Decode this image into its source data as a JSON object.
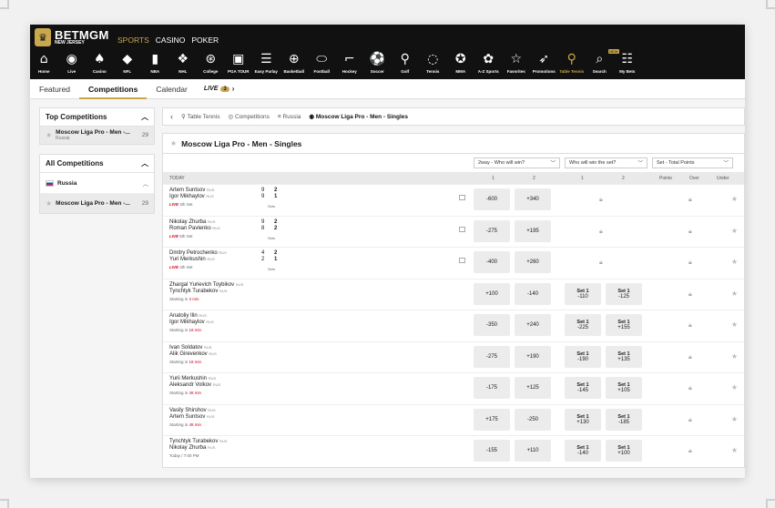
{
  "header": {
    "brand_top": "BETMGM",
    "brand_sub": "NEW JERSEY",
    "nav": [
      "SPORTS",
      "CASINO",
      "POKER"
    ],
    "nav_active": "SPORTS"
  },
  "iconnav": [
    {
      "label": "Home",
      "glyph": "⌂"
    },
    {
      "label": "Live",
      "glyph": "◉"
    },
    {
      "label": "Casino",
      "glyph": "♠"
    },
    {
      "label": "NFL",
      "glyph": "◆"
    },
    {
      "label": "NBA",
      "glyph": "▮"
    },
    {
      "label": "NHL",
      "glyph": "❖"
    },
    {
      "label": "College",
      "glyph": "⊛"
    },
    {
      "label": "PGA TOUR",
      "glyph": "▣"
    },
    {
      "label": "Easy Parlay",
      "glyph": "☰"
    },
    {
      "label": "Basketball",
      "glyph": "⊕"
    },
    {
      "label": "Football",
      "glyph": "⬭"
    },
    {
      "label": "Hockey",
      "glyph": "⌐"
    },
    {
      "label": "Soccer",
      "glyph": "⚽"
    },
    {
      "label": "Golf",
      "glyph": "⚲"
    },
    {
      "label": "Tennis",
      "glyph": "◌"
    },
    {
      "label": "MMA",
      "glyph": "✪"
    },
    {
      "label": "A-Z Sports",
      "glyph": "✿"
    },
    {
      "label": "Favorites",
      "glyph": "☆"
    },
    {
      "label": "Promotions",
      "glyph": "➶"
    },
    {
      "label": "Table Tennis",
      "glyph": "⚲"
    },
    {
      "label": "Search",
      "glyph": "⌕"
    },
    {
      "label": "My Bets",
      "glyph": "☷"
    }
  ],
  "search_badge": "NEW",
  "tabs": [
    "Featured",
    "Competitions",
    "Calendar"
  ],
  "live_tab": {
    "label": "LIVE",
    "count": "3"
  },
  "sidebar": {
    "top_title": "Top Competitions",
    "top_item": {
      "name": "Moscow Liga Pro - Men -...",
      "sub": "Russia",
      "count": "29"
    },
    "all_title": "All Competitions",
    "country": "Russia",
    "all_item": {
      "name": "Moscow Liga Pro - Men -...",
      "count": "29"
    }
  },
  "breadcrumb": [
    "Table Tennis",
    "Competitions",
    "Russia",
    "Moscow Liga Pro - Men - Singles"
  ],
  "main_title": "Moscow Liga Pro - Men - Singles",
  "markets": {
    "m1": "2way - Who will win?",
    "m2": "Who will win the set?",
    "m3": "Set - Total Points"
  },
  "columns": {
    "today": "TODAY",
    "c1": "1",
    "c2": "2",
    "c3": "1",
    "c4": "2",
    "points": "Points",
    "over": "Over",
    "under": "Under"
  },
  "rus": "RUS",
  "sets_label": "Sets",
  "set_label": "Set 1",
  "matches": [
    {
      "p1": "Artem Suntsov",
      "p2": "Igor Mikhaylov",
      "live": "LIVE",
      "info": "4th Set",
      "s1a": "9",
      "s1b": "2",
      "s2a": "9",
      "s2b": "1",
      "o1": "-600",
      "o2": "+340"
    },
    {
      "p1": "Nikolay Zhurba",
      "p2": "Roman Pavlenko",
      "live": "LIVE",
      "info": "5th Set",
      "s1a": "9",
      "s1b": "2",
      "s2a": "8",
      "s2b": "2",
      "o1": "-275",
      "o2": "+195"
    },
    {
      "p1": "Dmitry Petrochenko",
      "p2": "Yuri Merkushin",
      "live": "LIVE",
      "info": "4th Set",
      "s1a": "4",
      "s1b": "2",
      "s2a": "2",
      "s2b": "1",
      "o1": "-400",
      "o2": "+260"
    },
    {
      "p1": "Zhargal Yurievich Toybikov",
      "p2": "Tynchtyk Turabekov",
      "pre": "Starting in",
      "mins": "3 min",
      "o1": "+100",
      "o2": "-140",
      "s1": "-110",
      "s2": "-125"
    },
    {
      "p1": "Anatoliy Ilin",
      "p2": "Igor Mikhaylov",
      "pre": "Starting in",
      "mins": "18 min",
      "o1": "-350",
      "o2": "+240",
      "s1": "-225",
      "s2": "+155"
    },
    {
      "p1": "Ivan Soldatov",
      "p2": "Alik Girevenkov",
      "pre": "Starting in",
      "mins": "18 min",
      "o1": "-275",
      "o2": "+190",
      "s1": "-190",
      "s2": "+135"
    },
    {
      "p1": "Yurii Merkushin",
      "p2": "Aleksandr Volkov",
      "pre": "Starting in",
      "mins": "48 min",
      "o1": "-175",
      "o2": "+125",
      "s1": "-145",
      "s2": "+105"
    },
    {
      "p1": "Vasily Shirshov",
      "p2": "Artem Suntsov",
      "pre": "Starting in",
      "mins": "48 min",
      "o1": "+175",
      "o2": "-250",
      "s1": "+130",
      "s2": "-185"
    },
    {
      "p1": "Tynchtyk Turabekov",
      "p2": "Nikolay Zhurba",
      "pre": "Today / 7:00 PM",
      "o1": "-155",
      "o2": "+110",
      "s1": "-140",
      "s2": "+100"
    }
  ]
}
